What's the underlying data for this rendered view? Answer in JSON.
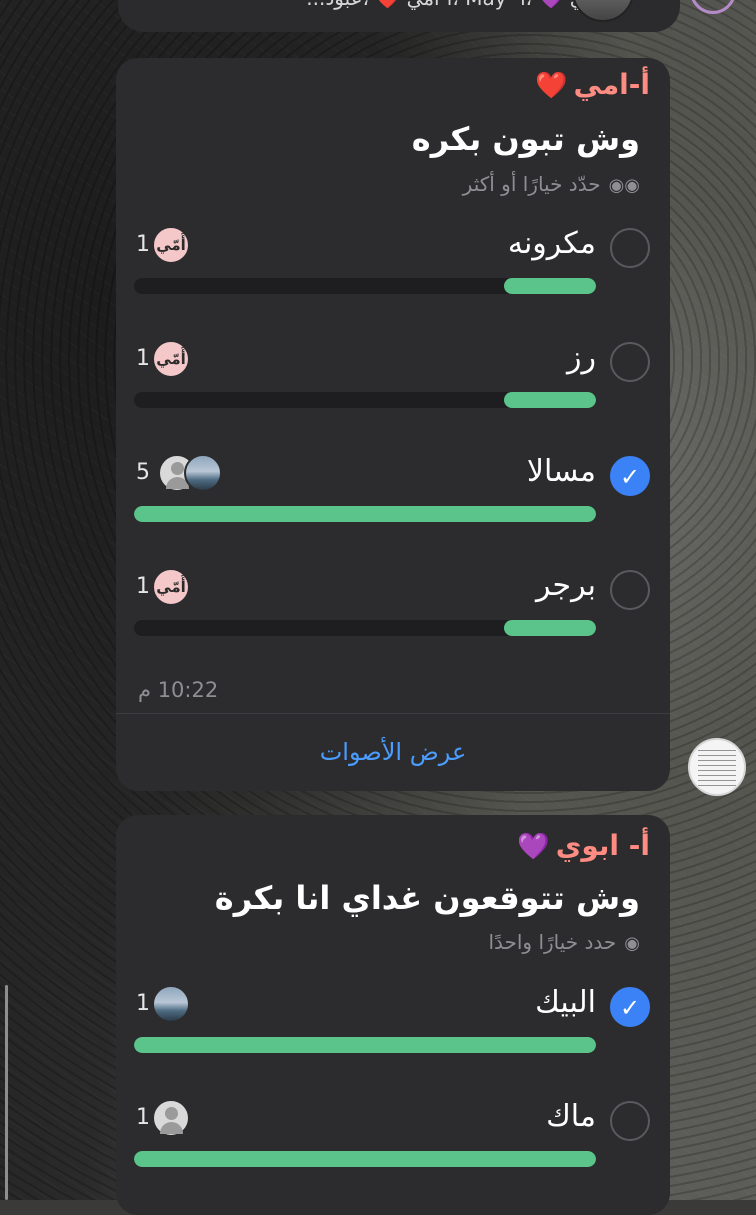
{
  "pinned_bar": {
    "text": "أ- ابوي 💜 ،أ- May ،أ-امي ❤️ ،عبود..."
  },
  "poll1": {
    "sender": "أ-امي",
    "sender_color": "#ff8c82",
    "sender_emoji": "❤️",
    "question": "وش تبون بكره",
    "hint": "حدّد خيارًا أو أكثر",
    "options": [
      {
        "label": "مكرونه",
        "count": "1",
        "selected": false,
        "fill": 0.2
      },
      {
        "label": "رز",
        "count": "1",
        "selected": false,
        "fill": 0.2
      },
      {
        "label": "مسالا",
        "count": "5",
        "selected": true,
        "fill": 1.0
      },
      {
        "label": "برجر",
        "count": "1",
        "selected": false,
        "fill": 0.2
      }
    ],
    "voter_badge_text": "أُمّي",
    "time": "10:22 م",
    "view_votes": "عرض الأصوات"
  },
  "poll2": {
    "sender": "أ- ابوي",
    "sender_color": "#ff8c82",
    "sender_emoji": "💜",
    "question": "وش تتوقعون غداي انا بكرة",
    "hint": "حدد خيارًا واحدًا",
    "options": [
      {
        "label": "البيك",
        "count": "1",
        "selected": true,
        "fill": 1.0
      },
      {
        "label": "ماك",
        "count": "1",
        "selected": false,
        "fill": 1.0
      }
    ]
  },
  "colors": {
    "bubble": "#2c2c2e",
    "bar_fill": "#5ac48a",
    "check": "#3b82f6",
    "link": "#4a9dff"
  },
  "check_glyph": "✓"
}
